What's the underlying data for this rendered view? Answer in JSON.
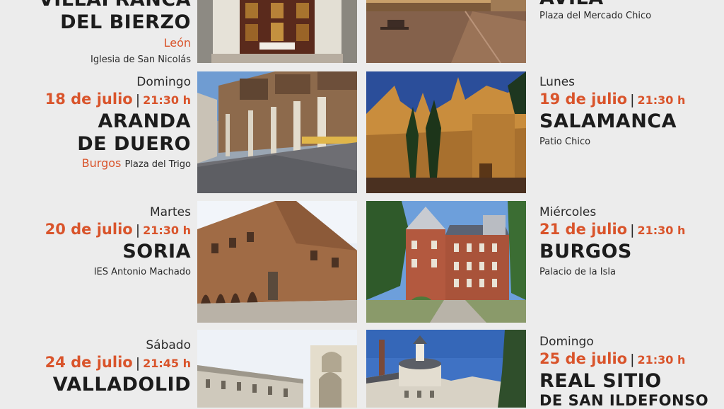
{
  "events": [
    {
      "day": "",
      "date": "",
      "time": "",
      "city_lines": [
        "VILLAFRANCA",
        "DEL BIERZO"
      ],
      "province": "León",
      "venue": "Iglesia de San Nicolás"
    },
    {
      "day": "",
      "date": "",
      "time": "",
      "city_lines": [
        "ÁVILA"
      ],
      "province": "",
      "venue": "Plaza del Mercado Chico"
    },
    {
      "day": "Domingo",
      "date": "18 de julio",
      "time": "21:30 h",
      "city_lines": [
        "ARANDA",
        "DE DUERO"
      ],
      "province": "Burgos",
      "venue": "Plaza del Trigo"
    },
    {
      "day": "Lunes",
      "date": "19 de julio",
      "time": "21:30 h",
      "city_lines": [
        "SALAMANCA"
      ],
      "province": "",
      "venue": "Patio Chico"
    },
    {
      "day": "Martes",
      "date": "20 de julio",
      "time": "21:30 h",
      "city_lines": [
        "SORIA"
      ],
      "province": "",
      "venue": "IES Antonio Machado"
    },
    {
      "day": "Miércoles",
      "date": "21 de julio",
      "time": "21:30 h",
      "city_lines": [
        "BURGOS"
      ],
      "province": "",
      "venue": "Palacio de la Isla"
    },
    {
      "day": "Sábado",
      "date": "24 de julio",
      "time": "21:45 h",
      "city_lines": [
        "VALLADOLID"
      ],
      "province": "",
      "venue": ""
    },
    {
      "day": "Domingo",
      "date": "25 de julio",
      "time": "21:30 h",
      "city_lines": [
        "REAL SITIO",
        "DE SAN ILDEFONSO"
      ],
      "province": "",
      "venue": ""
    }
  ],
  "colors": {
    "accent": "#d9542b",
    "background": "#ececec",
    "text": "#1f1f1f"
  }
}
